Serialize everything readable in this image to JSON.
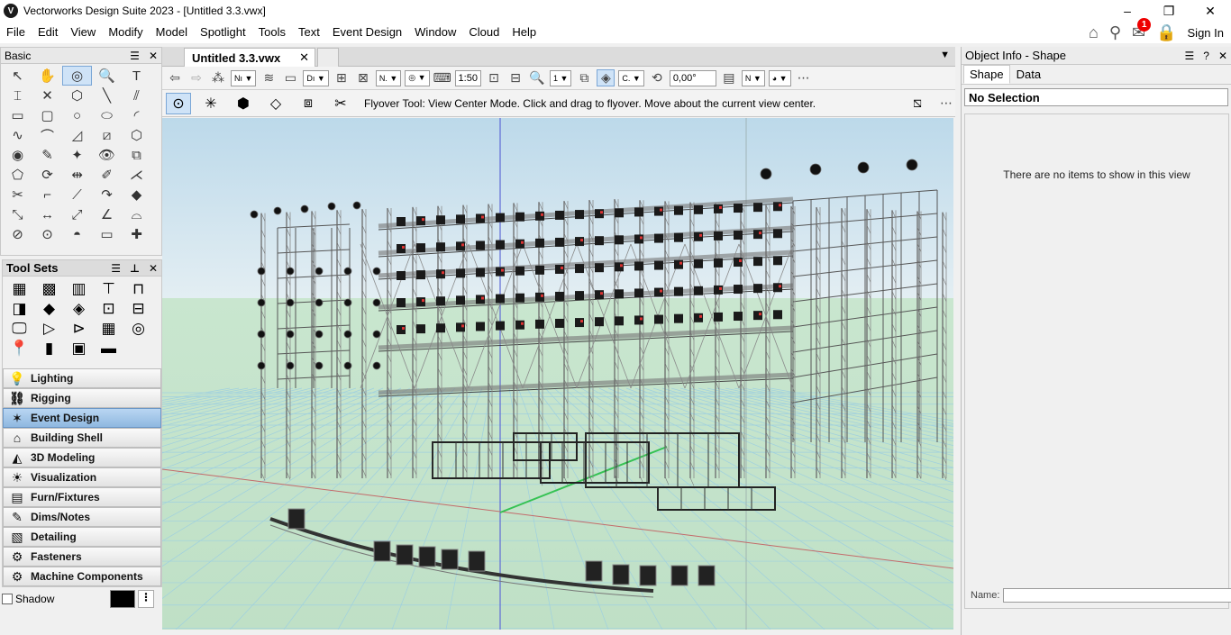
{
  "window": {
    "title": "Vectorworks Design Suite 2023 - [Untitled 3.3.vwx]",
    "app_icon": "V"
  },
  "menu": [
    "File",
    "Edit",
    "View",
    "Modify",
    "Model",
    "Spotlight",
    "Tools",
    "Text",
    "Event Design",
    "Window",
    "Cloud",
    "Help"
  ],
  "menu_right": {
    "notification_count": "1",
    "sign_in": "Sign In"
  },
  "basic_palette": {
    "title": "Basic",
    "selected_tool": "flyover-tool"
  },
  "tool_sets": {
    "title": "Tool Sets",
    "categories": [
      "Lighting",
      "Rigging",
      "Event Design",
      "Building Shell",
      "3D Modeling",
      "Visualization",
      "Furn/Fixtures",
      "Dims/Notes",
      "Detailing",
      "Fasteners",
      "Machine Components"
    ],
    "selected_category": "Event Design"
  },
  "shadow": {
    "label": "Shadow"
  },
  "document": {
    "tab_title": "Untitled 3.3.vwx"
  },
  "view_bar": {
    "class_field": "Nı",
    "design_layer_field": "Dı",
    "render_field": "N.",
    "scale": "1:50",
    "page_number": "1",
    "view_field": "C.",
    "rotation": "0,00°",
    "plane_field": "N"
  },
  "mode_bar": {
    "hint": "Flyover Tool: View Center Mode. Click and drag to flyover.  Move about the current view center."
  },
  "object_info": {
    "title": "Object Info - Shape",
    "tabs": [
      "Shape",
      "Data"
    ],
    "selection": "No Selection",
    "empty_message": "There are no items to show in this view",
    "name_label": "Name:"
  },
  "colors": {
    "sky_top": "#bcd9ea",
    "ground": "#c9e6cf",
    "selection_blue": "#cfe3f7",
    "truss_gray": "#8a8a8a"
  }
}
